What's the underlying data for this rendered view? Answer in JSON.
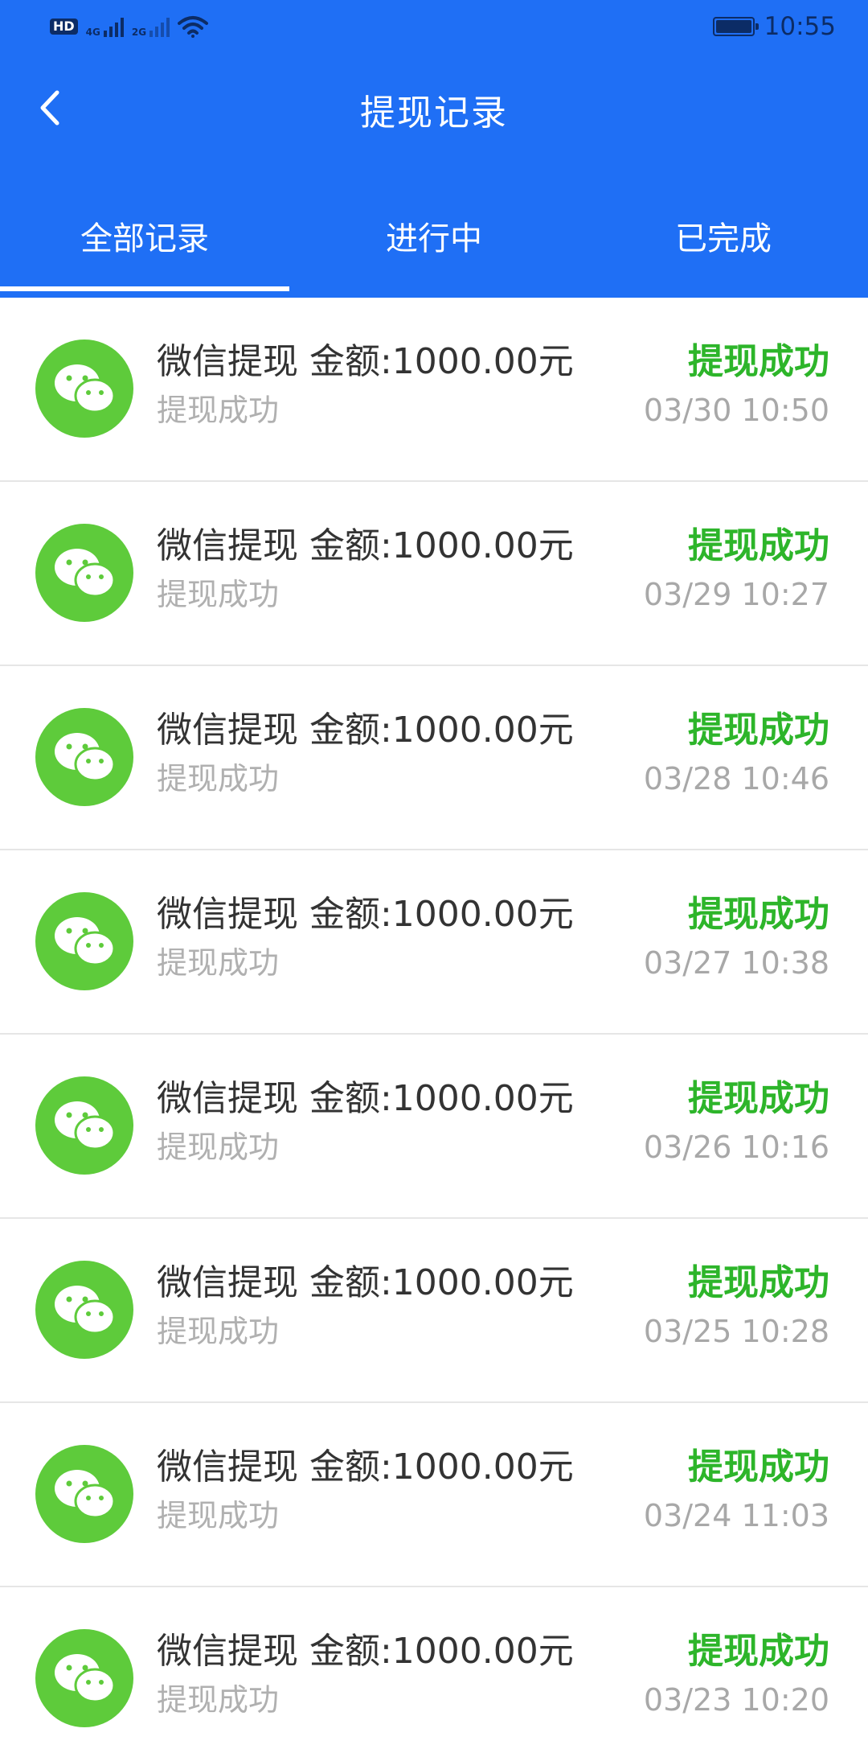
{
  "status_bar": {
    "hd_badge": "HD",
    "network_1": "4G",
    "network_2": "2G",
    "wifi_icon": "wifi-icon",
    "battery_icon": "battery-icon",
    "time": "10:55"
  },
  "header": {
    "back_icon": "chevron-left-icon",
    "title": "提现记录",
    "background_color": "#1f6ff5"
  },
  "tabs": [
    {
      "label": "全部记录",
      "active": true
    },
    {
      "label": "进行中",
      "active": false
    },
    {
      "label": "已完成",
      "active": false
    }
  ],
  "records": [
    {
      "icon": "wechat-icon",
      "title": "微信提现 金额:1000.00元",
      "subtitle": "提现成功",
      "status": "提现成功",
      "time": "03/30 10:50"
    },
    {
      "icon": "wechat-icon",
      "title": "微信提现 金额:1000.00元",
      "subtitle": "提现成功",
      "status": "提现成功",
      "time": "03/29 10:27"
    },
    {
      "icon": "wechat-icon",
      "title": "微信提现 金额:1000.00元",
      "subtitle": "提现成功",
      "status": "提现成功",
      "time": "03/28 10:46"
    },
    {
      "icon": "wechat-icon",
      "title": "微信提现 金额:1000.00元",
      "subtitle": "提现成功",
      "status": "提现成功",
      "time": "03/27 10:38"
    },
    {
      "icon": "wechat-icon",
      "title": "微信提现 金额:1000.00元",
      "subtitle": "提现成功",
      "status": "提现成功",
      "time": "03/26 10:16"
    },
    {
      "icon": "wechat-icon",
      "title": "微信提现 金额:1000.00元",
      "subtitle": "提现成功",
      "status": "提现成功",
      "time": "03/25 10:28"
    },
    {
      "icon": "wechat-icon",
      "title": "微信提现 金额:1000.00元",
      "subtitle": "提现成功",
      "status": "提现成功",
      "time": "03/24 11:03"
    },
    {
      "icon": "wechat-icon",
      "title": "微信提现 金额:1000.00元",
      "subtitle": "提现成功",
      "status": "提现成功",
      "time": "03/23 10:20"
    }
  ],
  "colors": {
    "accent_blue": "#1f6ff5",
    "success_green": "#2db52a",
    "wechat_green": "#5ecb3b",
    "muted_gray": "#b0b0b0"
  }
}
